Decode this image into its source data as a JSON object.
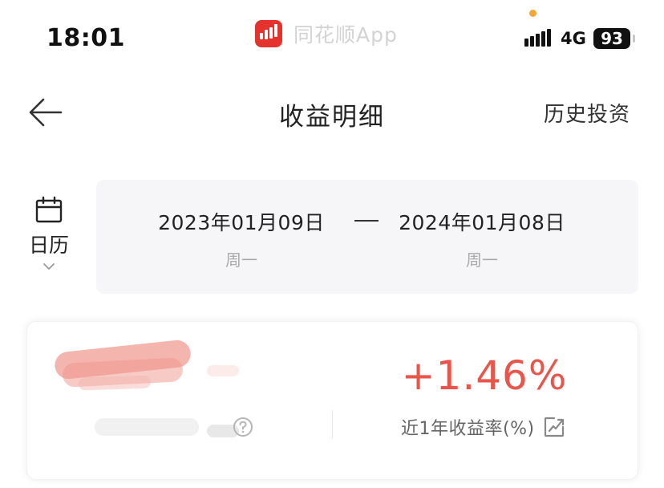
{
  "status_bar": {
    "time": "18:01",
    "app_source": "同花顺App",
    "network": "4G",
    "battery": "93",
    "icons": [
      "app-logo-icon",
      "signal-bars-icon",
      "battery-icon"
    ]
  },
  "nav": {
    "title": "收益明细",
    "history_link": "历史投资",
    "back_icon": "arrow-left-icon"
  },
  "calendar": {
    "label": "日历",
    "icon": "calendar-icon",
    "expand_icon": "chevron-down-icon"
  },
  "date_range": {
    "start": {
      "date": "2023年01月09日",
      "weekday": "周一"
    },
    "end": {
      "date": "2024年01月08日",
      "weekday": "周一"
    }
  },
  "summary": {
    "return_rate": "+1.46%",
    "return_label": "近1年收益率(%)",
    "help_icon": "question-circle-icon",
    "chart_icon": "trend-chart-icon"
  },
  "colors": {
    "accent_red": "#e8554a",
    "logo_red": "#e5322d",
    "date_panel_bg": "#f6f6f8",
    "muted_text": "#aaaaaa"
  }
}
